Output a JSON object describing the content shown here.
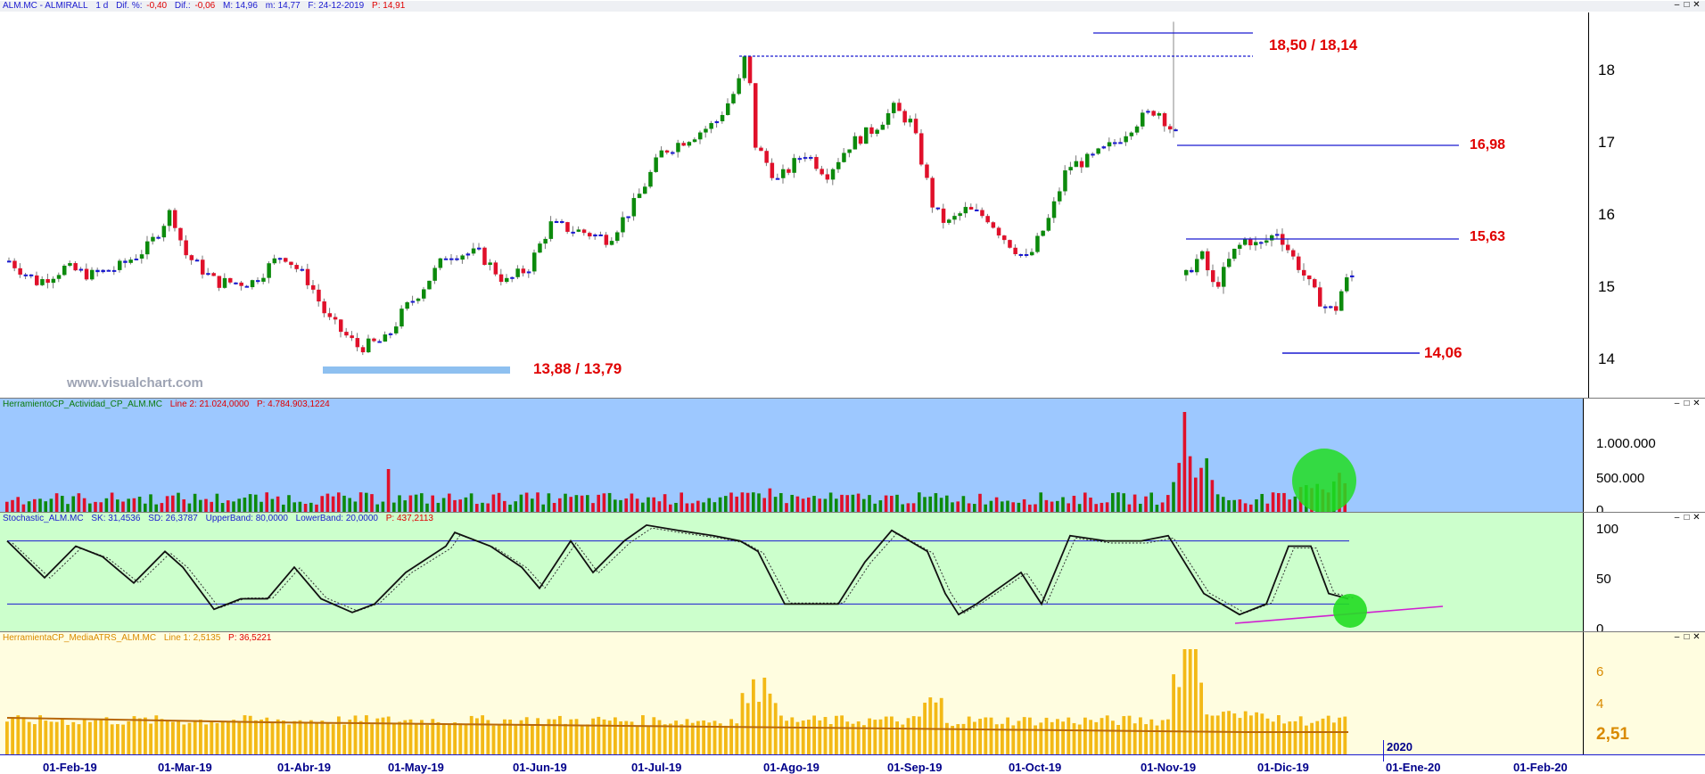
{
  "main": {
    "header": {
      "symbol": "ALM.MC - ALMIRALL",
      "period": "1 d",
      "dif_pct_label": "Dif. %:",
      "dif_pct": "-0,40",
      "dif_label": "Dif.:",
      "dif": "-0,06",
      "max": "M: 14,96",
      "min": "m: 14,77",
      "date": "F: 24-12-2019",
      "price": "P: 14,91"
    },
    "watermark": "www.visualchart.com",
    "price_labels": [
      "18",
      "17",
      "16",
      "15",
      "14"
    ],
    "annotations": {
      "top_range": "18,50 / 18,14",
      "level_1698": "16,98",
      "level_1563": "15,63",
      "level_1406": "14,06",
      "low_range": "13,88 / 13,79"
    }
  },
  "volume": {
    "header_name": "HerramientoCP_Actividad_CP_ALM.MC",
    "header_line": "Line 2: 21.024,0000",
    "header_p": "P: 4.784.903,1224",
    "axis_labels": [
      "1.000.000",
      "500.000",
      "0"
    ]
  },
  "stochastic": {
    "header_name": "Stochastic_ALM.MC",
    "sk": "SK: 31,4536",
    "sd": "SD: 26,3787",
    "upper": "UpperBand: 80,0000",
    "lower": "LowerBand: 20,0000",
    "p": "P: 437,2113",
    "axis_labels": [
      "100",
      "50",
      "0"
    ]
  },
  "atr": {
    "header_name": "HerramientaCP_MediaATRS_ALM.MC",
    "line": "Line 1: 2,5135",
    "p": "P: 36,5221",
    "axis_labels": [
      "6",
      "4",
      "2,51"
    ]
  },
  "x_axis": {
    "dates": [
      "01-Feb-19",
      "01-Mar-19",
      "01-Abr-19",
      "01-May-19",
      "01-Jun-19",
      "01-Jul-19",
      "01-Ago-19",
      "01-Sep-19",
      "01-Oct-19",
      "01-Nov-19",
      "01-Dic-19",
      "01-Ene-20",
      "01-Feb-20"
    ],
    "year_marker": "2020"
  },
  "colors": {
    "up": "#0c8a0c",
    "down": "#e0102a",
    "neutral": "#1a1ad0",
    "levels": "#1a1ad0",
    "annotation": "#e00000",
    "volume_bg": "#9dc8ff",
    "stoch_bg": "#ccffcc",
    "atr_bg": "#fffde0",
    "atr_bar": "#f3b916"
  }
}
